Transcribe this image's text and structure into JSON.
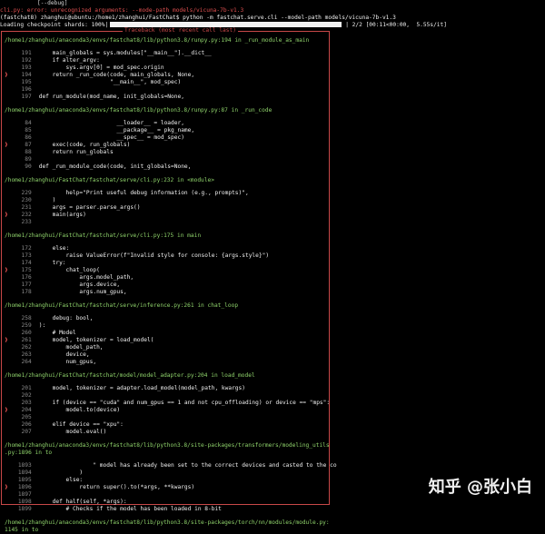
{
  "header": {
    "debug_line": "           [--debug]",
    "error_line": "cli.py: error: unrecognized arguments: --mode-path models/vicuna-7b-v1.3",
    "prompt_line": "(fastchat8) zhanghui@ubuntu:/home1/zhanghui/FastChat$ python -m fastchat.serve.cli --model-path models/vicuna-7b-v1.3",
    "loading_prefix": "Loading checkpoint shards: 100%|",
    "loading_suffix": "| 2/2 [00:11<00:00,  5.55s/it]",
    "progress_fraction": 1.0
  },
  "traceback": {
    "title": "Traceback (most recent call last)",
    "frames": [
      {
        "path": "/home1/zhanghui/anaconda3/envs/fastchat8/lib/python3.8/runpy.py:194 in _run_module_as_main",
        "lines": [
          {
            "n": "191",
            "code": "    main_globals = sys.modules[\"__main__\"].__dict__",
            "active": false
          },
          {
            "n": "192",
            "code": "    if alter_argv:",
            "active": false
          },
          {
            "n": "193",
            "code": "        sys.argv[0] = mod_spec.origin",
            "active": false
          },
          {
            "n": "194",
            "code": "    return _run_code(code, main_globals, None,",
            "active": true
          },
          {
            "n": "195",
            "code": "                     \"__main__\", mod_spec)",
            "active": false
          },
          {
            "n": "196",
            "code": "",
            "active": false
          },
          {
            "n": "197",
            "code": "def run_module(mod_name, init_globals=None,",
            "active": false
          }
        ]
      },
      {
        "path": "/home1/zhanghui/anaconda3/envs/fastchat8/lib/python3.8/runpy.py:87 in _run_code",
        "lines": [
          {
            "n": "84",
            "code": "                       __loader__ = loader,",
            "active": false
          },
          {
            "n": "85",
            "code": "                       __package__ = pkg_name,",
            "active": false
          },
          {
            "n": "86",
            "code": "                       __spec__ = mod_spec)",
            "active": false
          },
          {
            "n": "87",
            "code": "    exec(code, run_globals)",
            "active": true
          },
          {
            "n": "88",
            "code": "    return run_globals",
            "active": false
          },
          {
            "n": "89",
            "code": "",
            "active": false
          },
          {
            "n": "90",
            "code": "def _run_module_code(code, init_globals=None,",
            "active": false
          }
        ]
      },
      {
        "path": "/home1/zhanghui/FastChat/fastchat/serve/cli.py:232 in <module>",
        "lines": [
          {
            "n": "229",
            "code": "        help=\"Print useful debug information (e.g., prompts)\",",
            "active": false
          },
          {
            "n": "230",
            "code": "    )",
            "active": false
          },
          {
            "n": "231",
            "code": "    args = parser.parse_args()",
            "active": false
          },
          {
            "n": "232",
            "code": "    main(args)",
            "active": true
          },
          {
            "n": "233",
            "code": "",
            "active": false
          }
        ]
      },
      {
        "path": "/home1/zhanghui/FastChat/fastchat/serve/cli.py:175 in main",
        "lines": [
          {
            "n": "172",
            "code": "    else:",
            "active": false
          },
          {
            "n": "173",
            "code": "        raise ValueError(f\"Invalid style for console: {args.style}\")",
            "active": false
          },
          {
            "n": "174",
            "code": "    try:",
            "active": false
          },
          {
            "n": "175",
            "code": "        chat_loop(",
            "active": true
          },
          {
            "n": "176",
            "code": "            args.model_path,",
            "active": false
          },
          {
            "n": "177",
            "code": "            args.device,",
            "active": false
          },
          {
            "n": "178",
            "code": "            args.num_gpus,",
            "active": false
          }
        ]
      },
      {
        "path": "/home1/zhanghui/FastChat/fastchat/serve/inference.py:261 in chat_loop",
        "lines": [
          {
            "n": "258",
            "code": "    debug: bool,",
            "active": false
          },
          {
            "n": "259",
            "code": "):",
            "active": false
          },
          {
            "n": "260",
            "code": "    # Model",
            "active": false
          },
          {
            "n": "261",
            "code": "    model, tokenizer = load_model(",
            "active": true
          },
          {
            "n": "262",
            "code": "        model_path,",
            "active": false
          },
          {
            "n": "263",
            "code": "        device,",
            "active": false
          },
          {
            "n": "264",
            "code": "        num_gpus,",
            "active": false
          }
        ]
      },
      {
        "path": "/home1/zhanghui/FastChat/fastchat/model/model_adapter.py:204 in load_model",
        "lines": [
          {
            "n": "201",
            "code": "    model, tokenizer = adapter.load_model(model_path, kwargs)",
            "active": false
          },
          {
            "n": "202",
            "code": "",
            "active": false
          },
          {
            "n": "203",
            "code": "    if (device == \"cuda\" and num_gpus == 1 and not cpu_offloading) or device == \"mps\":",
            "active": false
          },
          {
            "n": "204",
            "code": "        model.to(device)",
            "active": true
          },
          {
            "n": "205",
            "code": "",
            "active": false
          },
          {
            "n": "206",
            "code": "    elif device == \"xpu\":",
            "active": false
          },
          {
            "n": "207",
            "code": "        model.eval()",
            "active": false
          }
        ]
      },
      {
        "path": "/home1/zhanghui/anaconda3/envs/fastchat8/lib/python3.8/site-packages/transformers/modeling_utils",
        "path2": ".py:1896 in to",
        "lines": [
          {
            "n": "1893",
            "code": "                \" model has already been set to the correct devices and casted to the co",
            "active": false
          },
          {
            "n": "1894",
            "code": "            )",
            "active": false
          },
          {
            "n": "1895",
            "code": "        else:",
            "active": false
          },
          {
            "n": "1896",
            "code": "            return super().to(*args, **kwargs)",
            "active": true
          },
          {
            "n": "1897",
            "code": "",
            "active": false
          },
          {
            "n": "1898",
            "code": "    def half(self, *args):",
            "active": false
          },
          {
            "n": "1899",
            "code": "        # Checks if the model has been loaded in 8-bit",
            "active": false
          }
        ]
      },
      {
        "path": "/home1/zhanghui/anaconda3/envs/fastchat8/lib/python3.8/site-packages/torch/nn/modules/module.py:",
        "path2": "1145 in to",
        "lines": []
      }
    ]
  },
  "watermark": "知乎 @张小白",
  "colors": {
    "border": "#c84848",
    "path": "#8fd36b",
    "arrow": "#e05050"
  }
}
